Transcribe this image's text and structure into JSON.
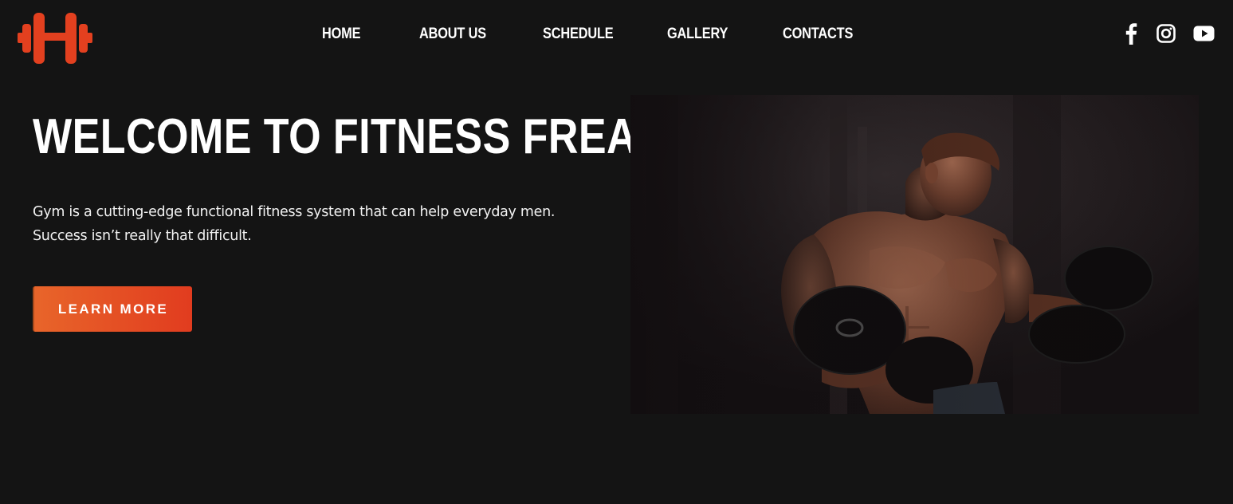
{
  "brand": {
    "logo_icon": "dumbbell-h-logo-icon",
    "accent_color": "#e3401f"
  },
  "nav": {
    "items": [
      {
        "label": "HOME"
      },
      {
        "label": "ABOUT US"
      },
      {
        "label": "SCHEDULE"
      },
      {
        "label": "GALLERY"
      },
      {
        "label": "CONTACTS"
      }
    ]
  },
  "social": {
    "icons": [
      "facebook-icon",
      "instagram-icon",
      "youtube-icon"
    ]
  },
  "hero": {
    "title": "WELCOME TO FITNESS FREAK",
    "description_lines": [
      "Gym is a cutting-edge functional fitness system that can help everyday men.",
      "Success isn’t really that difficult."
    ],
    "cta_label": "LEARN MORE",
    "cta_gradient": [
      "#e8652a",
      "#e13c1f"
    ],
    "image_subject": "bodybuilder-lifting-dumbbells-photo"
  },
  "colors": {
    "background": "#141414",
    "text": "#ffffff"
  }
}
